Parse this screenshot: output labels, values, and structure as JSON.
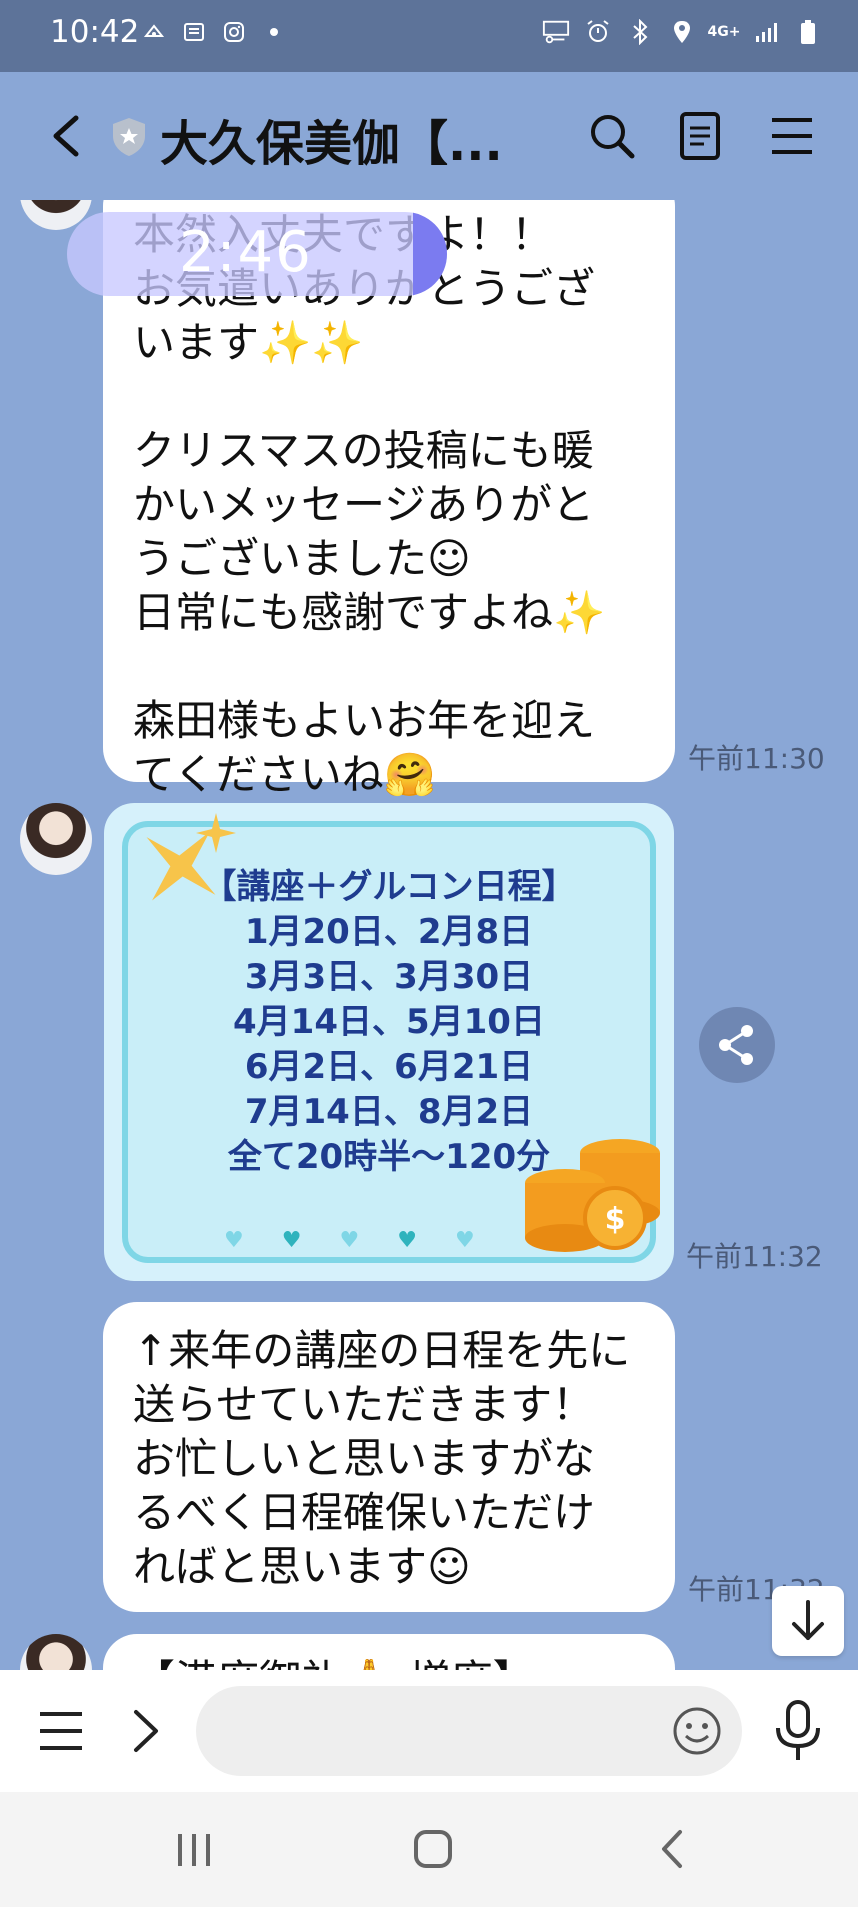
{
  "status_bar": {
    "time": "10:42",
    "left_icons": [
      "cloud-notify-icon",
      "news-icon",
      "instagram-icon",
      "dot-icon"
    ],
    "right_icons": [
      "screen-key-icon",
      "alarm-icon",
      "bluetooth-icon",
      "location-icon",
      "4g-icon",
      "signal-icon",
      "battery-icon"
    ],
    "network": "4G+"
  },
  "header": {
    "title": "大久保美伽【...",
    "icons": [
      "back-icon",
      "shield-icon",
      "search-icon",
      "notes-icon",
      "menu-icon"
    ]
  },
  "overlay": {
    "timer": "2:46"
  },
  "messages": [
    {
      "id": "msg1",
      "lines": [
        "本然入丈夫ですよ！！",
        "お気遣いありがとうござ",
        "います✨✨",
        "",
        "クリスマスの投稿にも暖",
        "かいメッセージありがと",
        "うございました☺",
        "日常にも感謝ですよね✨",
        "",
        "森田様もよいお年を迎え",
        "てくださいね🤗"
      ],
      "time": "午前11:30"
    },
    {
      "id": "msg2-image",
      "image_lines": [
        "【講座＋グルコン日程】",
        "1月20日、2月8日",
        "3月3日、3月30日",
        "4月14日、5月10日",
        "6月2日、6月21日",
        "7月14日、8月2日",
        "全て20時半〜120分"
      ],
      "hearts": [
        "♥",
        "♥",
        "♥",
        "♥",
        "♥"
      ],
      "time": "午前11:32"
    },
    {
      "id": "msg3",
      "lines": [
        "↑来年の講座の日程を先に",
        "送らせていただきます！",
        "お忙しいと思いますがな",
        "るべく日程確保いただけ",
        "ればと思います☺"
      ],
      "time": "午前11:32"
    },
    {
      "id": "msg4",
      "lines": [
        "【満席御礼🙏 増席】"
      ]
    }
  ],
  "composer": {
    "placeholder": "",
    "icons": [
      "menu-icon",
      "expand-icon",
      "emoji-icon",
      "mic-icon"
    ]
  },
  "nav": {
    "icons": [
      "recent-apps-icon",
      "home-icon",
      "back-icon"
    ]
  },
  "colors": {
    "chat_bg": "#8aa7d6",
    "status_bar": "#5d7399",
    "bubble": "#ffffff",
    "timer_overlay": "#c8c8ff"
  }
}
